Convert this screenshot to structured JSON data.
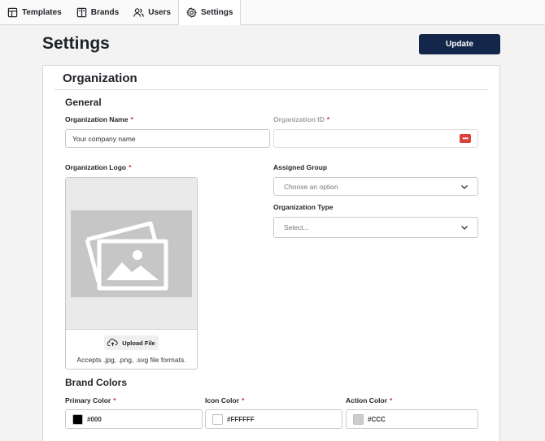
{
  "tabs": [
    {
      "label": "Templates",
      "icon": "template-icon",
      "active": false
    },
    {
      "label": "Brands",
      "icon": "book-icon",
      "active": false
    },
    {
      "label": "Users",
      "icon": "users-icon",
      "active": false
    },
    {
      "label": "Settings",
      "icon": "gear-icon",
      "active": true
    }
  ],
  "header": {
    "title": "Settings",
    "update_label": "Update"
  },
  "organization": {
    "section_title": "Organization",
    "general_title": "General",
    "name": {
      "label": "Organization Name",
      "required": "*",
      "value": "Your company name"
    },
    "id": {
      "label": "Organization ID",
      "required": "*",
      "value": ""
    },
    "logo": {
      "label": "Organization Logo",
      "required": "*",
      "upload_label": "Upload File",
      "hint": "Accepts .jpg, .png, .svg file formats."
    },
    "group": {
      "label": "Assigned Group",
      "placeholder": "Choose an option"
    },
    "type": {
      "label": "Organization Type",
      "placeholder": "Select..."
    }
  },
  "brand_colors": {
    "title": "Brand Colors",
    "primary": {
      "label": "Primary Color",
      "required": "*",
      "value": "#000",
      "swatch": "#000000"
    },
    "icon": {
      "label": "Icon Color",
      "required": "*",
      "value": "#FFFFFF",
      "swatch": "#FFFFFF"
    },
    "action": {
      "label": "Action Color",
      "required": "*",
      "value": "#CCC",
      "swatch": "#CCCCCC"
    }
  },
  "colors": {
    "accent": "#14264a",
    "required": "#d32f2f"
  }
}
